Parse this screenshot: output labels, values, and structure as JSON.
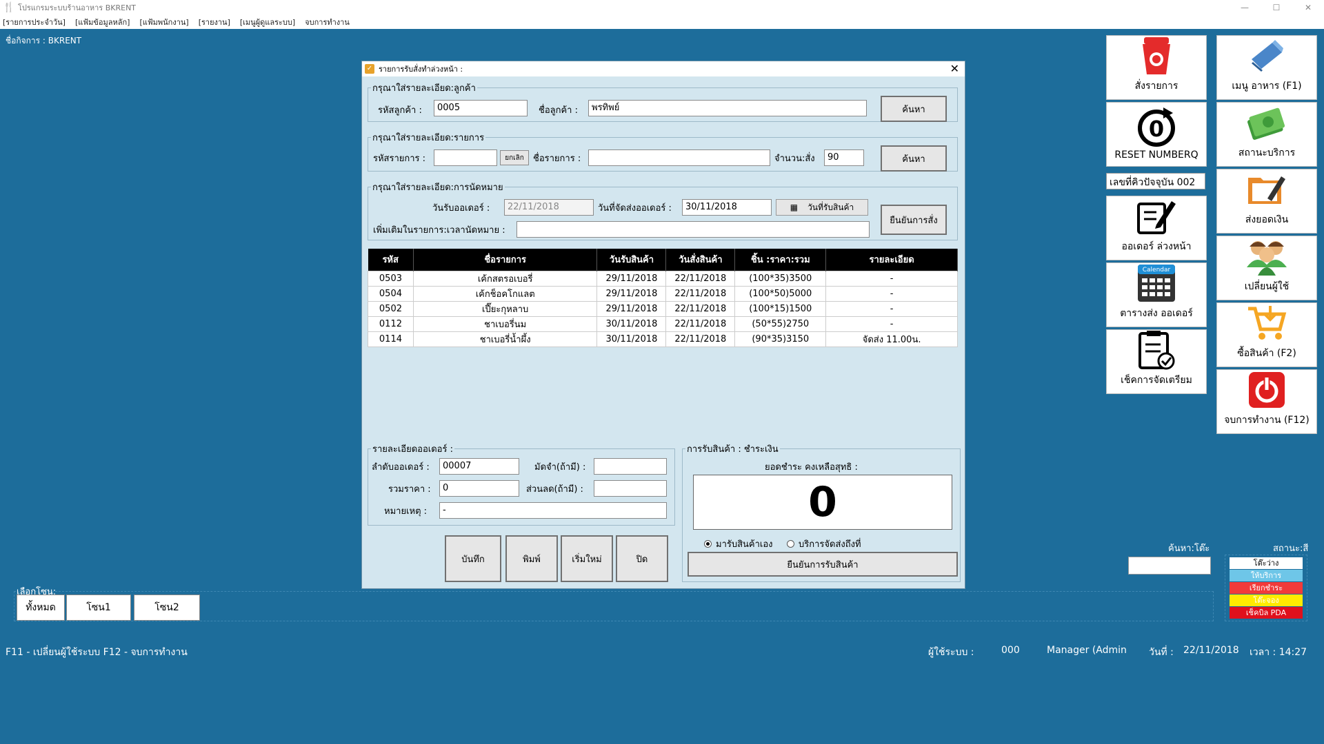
{
  "window": {
    "title": "โปรแกรมระบบร้านอาหาร BKRENT",
    "minimize": "—",
    "maximize": "☐",
    "close": "✕"
  },
  "menu": [
    "[รายการประจำวัน]",
    "[แฟ้มข้อมูลหลัก]",
    "[แฟ้มพนักงาน]",
    "[รายงาน]",
    "[เมนูผู้ดูแลระบบ]",
    "จบการทำงาน"
  ],
  "business": "ชื่อกิจการ : BKRENT",
  "dialog": {
    "title": "รายการรับสั่งทำล่วงหน้า :",
    "customer_group": "กรุณาใส่รายละเอียด:ลูกค้า",
    "customer_code_label": "รหัสลูกค้า :",
    "customer_code": "0005",
    "customer_name_label": "ชื่อลูกค้า :",
    "customer_name": "พรทิพย์",
    "search_label": "ค้นหา",
    "item_group": "กรุณาใส่รายละเอียด:รายการ",
    "item_code_label": "รหัสรายการ :",
    "item_code": "",
    "cancel_small": "ยกเลิก",
    "item_name_label": "ชื่อรายการ :",
    "item_name": "",
    "qty_label": "จำนวน:สั่ง",
    "qty": "90",
    "appt_group": "กรุณาใส่รายละเอียด:การนัดหมาย",
    "order_date_label": "วันรับออเดอร์ :",
    "order_date": "22/11/2018",
    "ship_date_label": "วันที่จัดส่งออเดอร์ :",
    "ship_date": "30/11/2018",
    "receive_date_btn": "วันที่รับสินค้า",
    "confirm_order": "ยืนยันการสั่ง",
    "extra_label": "เพิ่มเติมในรายการ:เวลานัดหมาย :",
    "extra_value": "",
    "table": {
      "headers": [
        "รหัส",
        "ชื่อรายการ",
        "วันรับสินค้า",
        "วันสั่งสินค้า",
        "ชิ้น :ราคา:รวม",
        "รายละเอียด"
      ],
      "rows": [
        [
          "0503",
          "เค้กสตรอเบอรี่",
          "29/11/2018",
          "22/11/2018",
          "(100*35)3500",
          "-"
        ],
        [
          "0504",
          "เค้กช็อคโกแลต",
          "29/11/2018",
          "22/11/2018",
          "(100*50)5000",
          "-"
        ],
        [
          "0502",
          "เปี๊ยะกุหลาบ",
          "29/11/2018",
          "22/11/2018",
          "(100*15)1500",
          "-"
        ],
        [
          "0112",
          "ชาเบอรี่นม",
          "30/11/2018",
          "22/11/2018",
          "(50*55)2750",
          "-"
        ],
        [
          "0114",
          "ชาเบอรี่น้ำผึ้ง",
          "30/11/2018",
          "22/11/2018",
          "(90*35)3150",
          "จัดส่ง 11.00น."
        ]
      ]
    },
    "order_detail_group": "รายละเอียดออเดอร์ :",
    "order_no_label": "ลำดับออเดอร์ :",
    "order_no": "00007",
    "deposit_label": "มัดจำ(ถ้ามี) :",
    "deposit": "",
    "total_label": "รวมราคา :",
    "total": "0",
    "discount_label": "ส่วนลด(ถ้ามี) :",
    "discount": "",
    "note_label": "หมายเหตุ :",
    "note": "-",
    "save": "บันทึก",
    "print": "พิมพ์",
    "new": "เริ่มใหม่",
    "close_btn": "ปิด",
    "payment_group": "การรับสินค้า : ชำระเงิน",
    "balance_label": "ยอดชำระ คงเหลือสุทธิ :",
    "balance": "0",
    "radio_self": "มารับสินค้าเอง",
    "radio_delivery": "บริการจัดส่งถึงที่",
    "confirm_receive": "ยืนยันการรับสินค้า"
  },
  "tiles": {
    "order": "สั่งรายการ",
    "food_menu": "เมนู อาหาร (F1)",
    "reset": "RESET NUMBERQ",
    "service_status": "สถานะบริการ",
    "send_money": "ส่งยอดเงิน",
    "advance_order": "ออเดอร์ ล่วงหน้า",
    "change_user": "เปลี่ยนผู้ใช้",
    "schedule": "ตารางส่ง ออเดอร์",
    "calendar_text": "Calendar",
    "buy": "ซื้อสินค้า (F2)",
    "check": "เช็คการจัดเตรียม",
    "exit": "จบการทำงาน (F12)"
  },
  "queue": "เลขที่คิวปัจจุบัน 002",
  "zones": {
    "label": "เลือกโซน:",
    "all": "ทั้งหมด",
    "z1": "โซน1",
    "z2": "โซน2"
  },
  "search_table_label": "ค้นหา:โต๊ะ",
  "status_label": "สถานะ:สี",
  "status_legend": [
    {
      "text": "โต๊ะว่าง",
      "bg": "#ffffff",
      "fg": "#000000"
    },
    {
      "text": "ให้บริการ",
      "bg": "#6ec6e8",
      "fg": "#ffffff"
    },
    {
      "text": "เรียกชำระ",
      "bg": "#f23a3a",
      "fg": "#ffffff"
    },
    {
      "text": "โต๊ะจอง",
      "bg": "#ffeb00",
      "fg": "#ffffff"
    },
    {
      "text": "เช็คบิล PDA",
      "bg": "#e0101c",
      "fg": "#ffffff"
    }
  ],
  "footer": {
    "shortcuts": "F11 - เปลี่ยนผู้ใช้ระบบ   F12 - จบการทำงาน",
    "user_label": "ผู้ใช้ระบบ :",
    "user_code": "000",
    "user_name": "Manager (Admin",
    "date_label": "วันที่ :",
    "date": "22/11/2018",
    "time_label": "เวลา : 14:27"
  },
  "colors": {
    "background": "#1d6d9b",
    "dialog": "#d3e6ef",
    "header": "#000000"
  }
}
